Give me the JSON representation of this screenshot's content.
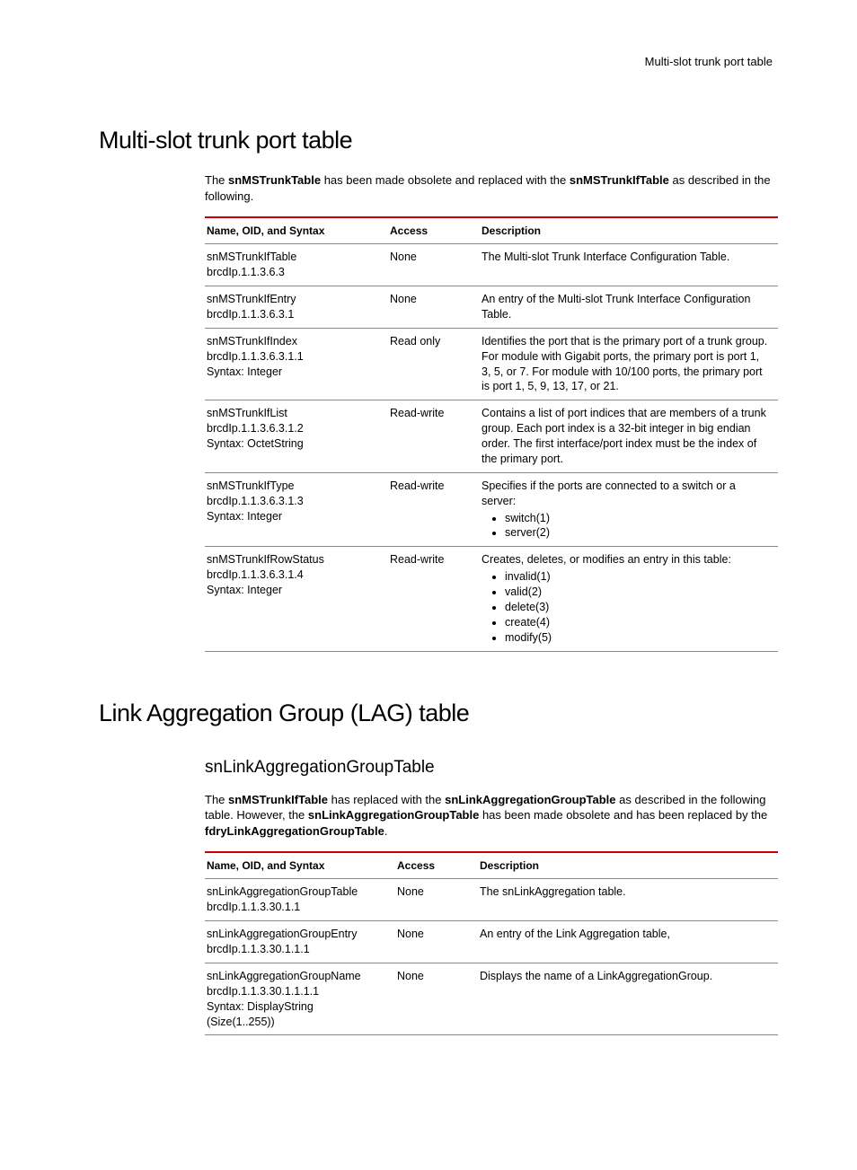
{
  "breadcrumb": "Multi-slot trunk port table",
  "section1": {
    "title": "Multi-slot trunk port table",
    "intro_p1": "The ",
    "intro_b1": "snMSTrunkTable",
    "intro_p2": " has been made obsolete and replaced with the ",
    "intro_b2": "snMSTrunkIfTable",
    "intro_p3": " as described in the following.",
    "th0": "Name, OID, and Syntax",
    "th1": "Access",
    "th2": "Description",
    "rows": [
      {
        "n1": "snMSTrunkIfTable",
        "n2": "brcdIp.1.1.3.6.3",
        "n3": "",
        "acc": "None",
        "desc": "The Multi-slot Trunk Interface Configuration Table."
      },
      {
        "n1": "snMSTrunkIfEntry",
        "n2": "brcdIp.1.1.3.6.3.1",
        "n3": "",
        "acc": "None",
        "desc": "An entry of the Multi-slot Trunk Interface Configuration Table."
      },
      {
        "n1": "snMSTrunkIfIndex",
        "n2": "brcdIp.1.1.3.6.3.1.1",
        "n3": "Syntax: Integer",
        "acc": "Read only",
        "desc": "Identifies the port that is the primary port of a trunk group. For module with Gigabit ports, the primary port is port 1, 3, 5, or 7. For module with 10/100 ports, the primary port is port 1, 5, 9, 13, 17, or 21."
      },
      {
        "n1": "snMSTrunkIfList",
        "n2": "brcdIp.1.1.3.6.3.1.2",
        "n3": "Syntax: OctetString",
        "acc": "Read-write",
        "desc": "Contains a list of port indices that are members of a trunk group. Each port index is a 32-bit integer in big endian order. The first interface/port index must be the index of the primary port."
      },
      {
        "n1": "snMSTrunkIfType",
        "n2": "brcdIp.1.1.3.6.3.1.3",
        "n3": "Syntax: Integer",
        "acc": "Read-write",
        "desc_lead": "Specifies if the ports are connected to a switch or a server:",
        "items": [
          "switch(1)",
          "server(2)"
        ]
      },
      {
        "n1": "snMSTrunkIfRowStatus",
        "n2": "brcdIp.1.1.3.6.3.1.4",
        "n3": "Syntax: Integer",
        "acc": "Read-write",
        "desc_lead": "Creates, deletes, or modifies an entry in this table:",
        "items": [
          "invalid(1)",
          "valid(2)",
          "delete(3)",
          "create(4)",
          "modify(5)"
        ]
      }
    ]
  },
  "section2": {
    "title": "Link Aggregation Group (LAG) table",
    "subtitle": "snLinkAggregationGroupTable",
    "p1": "The ",
    "b1": "snMSTrunkIfTable",
    "p2": " has replaced with the ",
    "b2": "snLinkAggregationGroupTable",
    "p3": " as described in the following table. However, the ",
    "b3": "snLinkAggregationGroupTable",
    "p4": " has been made obsolete and has been replaced by the ",
    "b4": "fdryLinkAggregationGroupTable",
    "p5": ".",
    "th0": "Name, OID, and Syntax",
    "th1": "Access",
    "th2": "Description",
    "rows": [
      {
        "n1": "snLinkAggregationGroupTable",
        "n2": "brcdIp.1.1.3.30.1.1",
        "n3": "",
        "n4": "",
        "acc": "None",
        "desc": "The snLinkAggregation table."
      },
      {
        "n1": "snLinkAggregationGroupEntry",
        "n2": "brcdIp.1.1.3.30.1.1.1",
        "n3": "",
        "n4": "",
        "acc": "None",
        "desc": "An entry of the Link Aggregation table,"
      },
      {
        "n1": "snLinkAggregationGroupName",
        "n2": "brcdIp.1.1.3.30.1.1.1.1",
        "n3": "Syntax: DisplayString",
        "n4": "(Size(1..255))",
        "acc": "None",
        "desc": "Displays the name of a LinkAggregationGroup."
      }
    ]
  }
}
